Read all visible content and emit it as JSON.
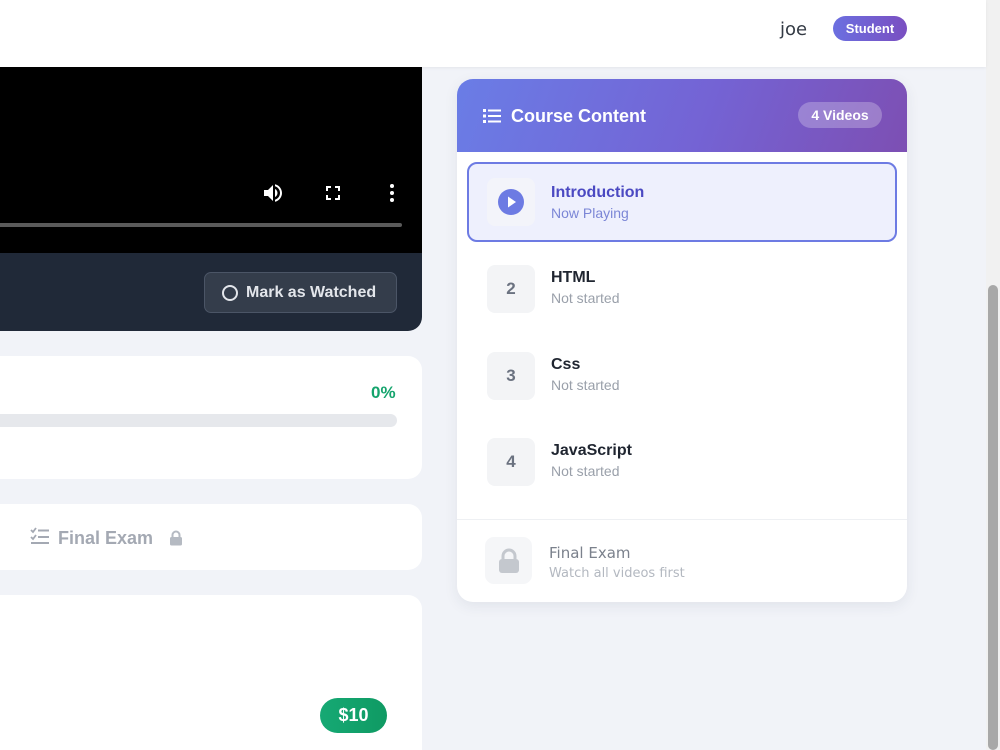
{
  "header": {
    "username": "joe",
    "role_badge": "Student"
  },
  "player": {
    "controls": [
      "volume-icon",
      "fullscreen-icon",
      "more-vert-icon"
    ],
    "mark_watched_label": "Mark as Watched"
  },
  "progress": {
    "percent_label": "0%",
    "value": 0
  },
  "tabs": {
    "final_exam_label": "Final Exam"
  },
  "pricing": {
    "price": "$10"
  },
  "course_content": {
    "title": "Course Content",
    "video_count": "4 Videos",
    "lessons": [
      {
        "number": "",
        "title": "Introduction",
        "status": "Now Playing",
        "active": true
      },
      {
        "number": "2",
        "title": "HTML",
        "status": "Not started",
        "active": false
      },
      {
        "number": "3",
        "title": "Css",
        "status": "Not started",
        "active": false
      },
      {
        "number": "4",
        "title": "JavaScript",
        "status": "Not started",
        "active": false
      }
    ],
    "final_exam": {
      "title": "Final Exam",
      "subtitle": "Watch all videos first"
    }
  },
  "colors": {
    "accent": "#6d7be3",
    "success": "#15a46d",
    "header_gradient_start": "#6a7de6",
    "header_gradient_end": "#7d4fb3"
  }
}
